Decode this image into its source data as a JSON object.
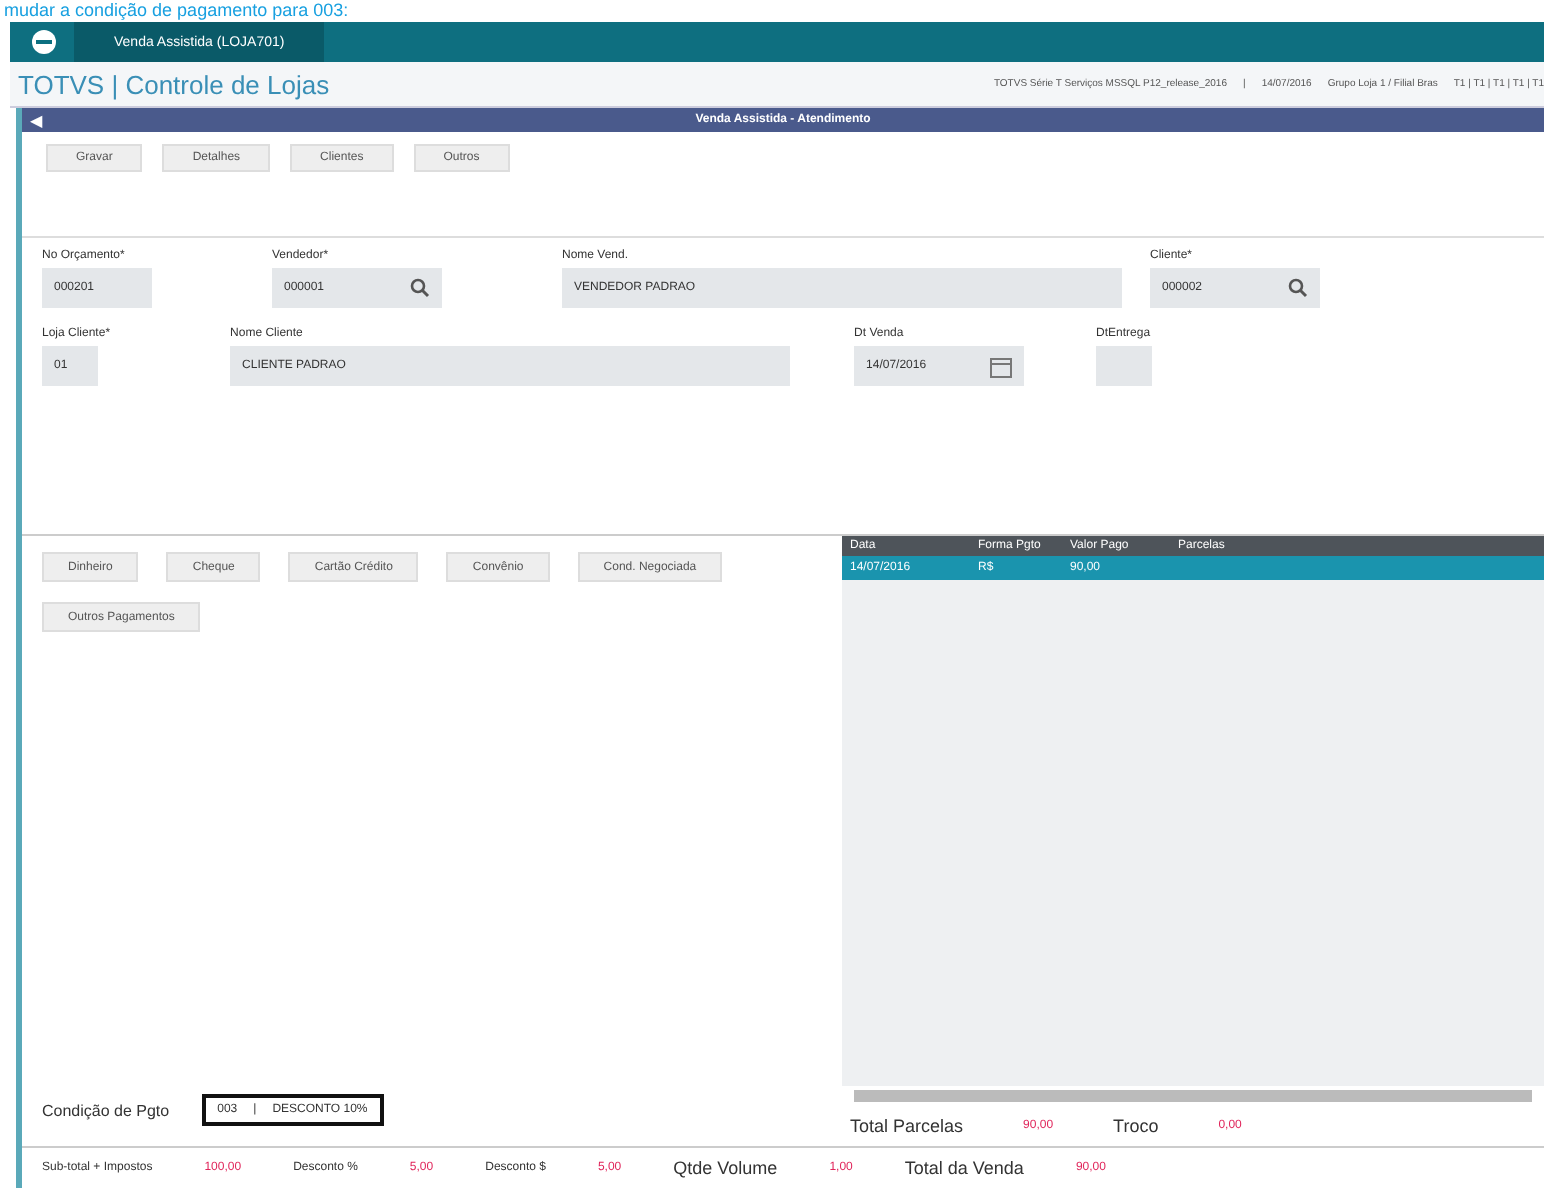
{
  "caption": "mudar a condição de pagamento para 003:",
  "app_tab": {
    "label": "Venda Assistida (LOJA701)"
  },
  "header": {
    "title": "TOTVS | Controle de Lojas",
    "info": [
      "TOTVS Série T Serviços MSSQL P12_release_2016",
      "|",
      "14/07/2016",
      "Grupo Loja 1 / Filial Bras",
      "T1 | T1 | T1 | T1 | T1"
    ]
  },
  "window": {
    "title": "Venda Assistida - Atendimento",
    "back_glyph": "◀"
  },
  "toolbar": [
    "Gravar",
    "Detalhes",
    "Clientes",
    "Outros"
  ],
  "fields": [
    {
      "label": "No Orçamento*",
      "value": "000201",
      "kind": "text"
    },
    {
      "label": "Vendedor*",
      "value": "000001",
      "kind": "lookup"
    },
    {
      "label": "Nome Vend.",
      "value": "VENDEDOR PADRAO",
      "kind": "text"
    },
    {
      "label": "Cliente*",
      "value": "000002",
      "kind": "lookup"
    },
    {
      "label": "Loja Cliente*",
      "value": "01",
      "kind": "text"
    },
    {
      "label": "Nome Cliente",
      "value": "CLIENTE PADRAO",
      "kind": "text"
    },
    {
      "label": "Dt Venda",
      "value": "14/07/2016",
      "kind": "date"
    },
    {
      "label": "DtEntrega",
      "kind": "text"
    }
  ],
  "payment_buttons": [
    "Dinheiro",
    "Cheque",
    "Cartão Crédito",
    "Convênio",
    "Cond. Negociada",
    "Outros Pagamentos"
  ],
  "table": {
    "columns": [
      "Data",
      "Forma Pgto",
      "Valor Pago",
      "Parcelas"
    ],
    "rows": [
      {
        "cells": [
          "14/07/2016",
          "R$",
          "90,00",
          ""
        ],
        "selected": true
      }
    ]
  },
  "condition": {
    "label": "Condição de Pgto",
    "code": "003",
    "separator": "|",
    "description": "DESCONTO 10%"
  },
  "totals_top": [
    {
      "label": "Total Parcelas",
      "value": "90,00"
    },
    {
      "label": "Troco",
      "value": "0,00"
    }
  ],
  "totals_bottom": [
    {
      "label": "Sub-total + Impostos",
      "value": "100,00"
    },
    {
      "label": "Desconto %",
      "value": "5,00"
    },
    {
      "label": "Desconto $",
      "value": "5,00"
    },
    {
      "label": "Qtde Volume",
      "value": "1,00"
    },
    {
      "label": "Total da Venda",
      "value": "90,00"
    }
  ]
}
